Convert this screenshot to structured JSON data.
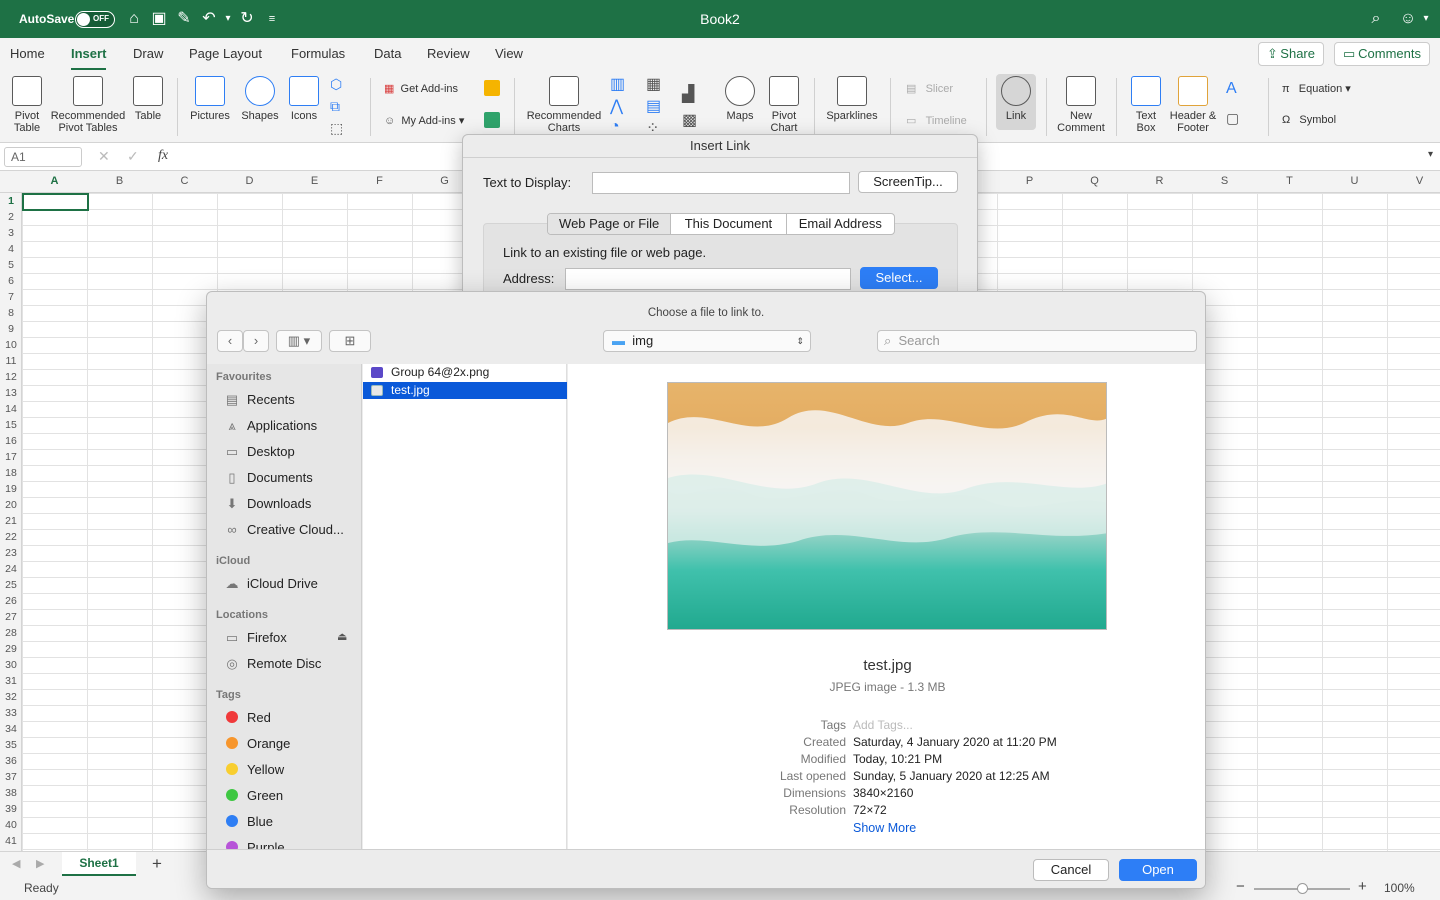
{
  "titlebar": {
    "title": "Book2",
    "autosave": "AutoSave",
    "autosave_state": "OFF"
  },
  "ribbon_tabs": [
    "Home",
    "Insert",
    "Draw",
    "Page Layout",
    "Formulas",
    "Data",
    "Review",
    "View"
  ],
  "active_tab": "Insert",
  "share_label": "Share",
  "comments_label": "Comments",
  "ribbon": {
    "pivot_table": "Pivot Table",
    "rec_pivot": "Recommended Pivot Tables",
    "table": "Table",
    "pictures": "Pictures",
    "shapes": "Shapes",
    "icons": "Icons",
    "get_addins": "Get Add-ins",
    "my_addins": "My Add-ins",
    "rec_charts": "Recommended Charts",
    "maps": "Maps",
    "pivot_chart": "Pivot Chart",
    "sparklines": "Sparklines",
    "slicer": "Slicer",
    "timeline": "Timeline",
    "link": "Link",
    "new_comment": "New Comment",
    "text_box": "Text Box",
    "header_footer": "Header & Footer",
    "equation": "Equation",
    "symbol": "Symbol"
  },
  "formula": {
    "cell_ref": "A1",
    "fx": "fx"
  },
  "columns": [
    "A",
    "B",
    "C",
    "D",
    "E",
    "F",
    "G",
    "",
    "",
    "",
    "",
    "",
    "",
    "",
    "",
    "P",
    "Q",
    "R",
    "S",
    "T",
    "U",
    "V"
  ],
  "rows": [
    "1",
    "2",
    "3",
    "4",
    "5",
    "6",
    "7",
    "8",
    "9",
    "10",
    "11",
    "12",
    "13",
    "14",
    "15",
    "16",
    "17",
    "18",
    "19",
    "20",
    "21",
    "22",
    "23",
    "24",
    "25",
    "26",
    "27",
    "28",
    "29",
    "30",
    "31",
    "32",
    "33",
    "34",
    "35",
    "36",
    "37",
    "38",
    "39",
    "40",
    "41"
  ],
  "sheet_tab": "Sheet1",
  "status": {
    "ready": "Ready",
    "zoom": "100%"
  },
  "insert_link": {
    "title": "Insert Link",
    "text_to_display_label": "Text to Display:",
    "screentip_button": "ScreenTip...",
    "segments": [
      "Web Page or File",
      "This Document",
      "Email Address"
    ],
    "instruction": "Link to an existing file or web page.",
    "address_label": "Address:",
    "select_button": "Select..."
  },
  "chooser": {
    "title": "Choose a file to link to.",
    "folder": "img",
    "search_placeholder": "Search",
    "sidebar": {
      "favourites_header": "Favourites",
      "favourites": [
        "Recents",
        "Applications",
        "Desktop",
        "Documents",
        "Downloads",
        "Creative Cloud..."
      ],
      "icloud_header": "iCloud",
      "icloud": [
        "iCloud Drive"
      ],
      "locations_header": "Locations",
      "locations": [
        "Firefox",
        "Remote Disc"
      ],
      "tags_header": "Tags",
      "tags": [
        {
          "name": "Red",
          "color": "#f0393a"
        },
        {
          "name": "Orange",
          "color": "#f7962d"
        },
        {
          "name": "Yellow",
          "color": "#f8ce2f"
        },
        {
          "name": "Green",
          "color": "#3ec742"
        },
        {
          "name": "Blue",
          "color": "#2e7ef4"
        },
        {
          "name": "Purple",
          "color": "#b754d8"
        }
      ]
    },
    "files": [
      "Group 64@2x.png",
      "test.jpg"
    ],
    "selected_file": "test.jpg",
    "preview": {
      "name": "test.jpg",
      "kind": "JPEG image - 1.3 MB",
      "tags_label": "Tags",
      "tags_placeholder": "Add Tags...",
      "created_label": "Created",
      "created": "Saturday, 4 January 2020 at 11:20 PM",
      "modified_label": "Modified",
      "modified": "Today, 10:21 PM",
      "last_opened_label": "Last opened",
      "last_opened": "Sunday, 5 January 2020 at 12:25 AM",
      "dimensions_label": "Dimensions",
      "dimensions": "3840×2160",
      "resolution_label": "Resolution",
      "resolution": "72×72",
      "show_more": "Show More"
    },
    "cancel_button": "Cancel",
    "open_button": "Open"
  },
  "colors": {
    "excel_green": "#1e7145",
    "accent_blue": "#0a59d9"
  }
}
